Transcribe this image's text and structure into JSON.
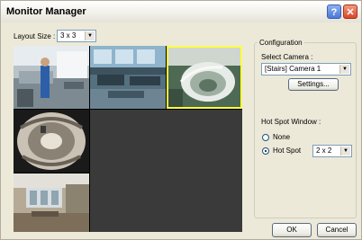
{
  "window": {
    "title": "Monitor Manager",
    "help_label": "?",
    "close_label": "✕"
  },
  "layout": {
    "label": "Layout Size :",
    "value": "3 x 3"
  },
  "cameras": [
    {
      "scene": "office-desk-figure"
    },
    {
      "scene": "open-plan-office"
    },
    {
      "scene": "spiral-staircase",
      "selected": true
    },
    {
      "scene": "fisheye-ceiling-view"
    },
    {
      "scene": "empty-office-room"
    }
  ],
  "config": {
    "legend": "Configuration",
    "select_camera_label": "Select Camera :",
    "camera_value": "[Stairs] Camera 1",
    "settings_label": "Settings...",
    "hotspot_label": "Hot Spot Window :",
    "option_none": "None",
    "option_hotspot": "Hot Spot",
    "hotspot_size": "2 x 2",
    "selected_option": "hotspot"
  },
  "footer": {
    "ok_label": "OK",
    "cancel_label": "Cancel"
  },
  "colors": {
    "selected_border": "#ffff44",
    "empty_cell": "#3a3a3a"
  }
}
